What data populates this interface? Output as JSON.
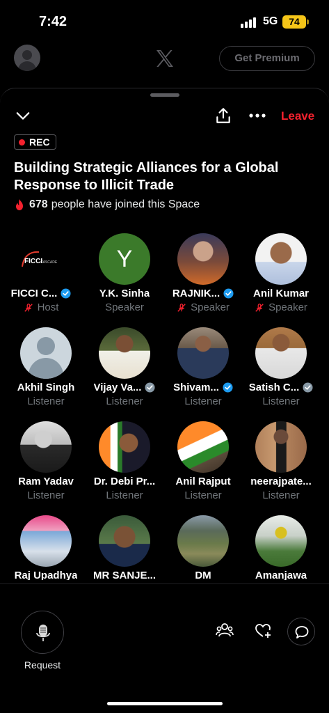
{
  "status_bar": {
    "time": "7:42",
    "network": "5G",
    "battery": "74"
  },
  "header": {
    "premium_label": "Get Premium"
  },
  "space": {
    "leave_label": "Leave",
    "rec_label": "REC",
    "title": "Building Strategic Alliances for a Global Response to Illicit Trade",
    "joined_count": "678",
    "joined_text": "people have joined this Space",
    "ficci_logo_text": "FICCI",
    "ficci_logo_sub": "CASCADE",
    "default_avatar_letter": "Y"
  },
  "participants": [
    {
      "name": "FICCI C...",
      "role": "Host",
      "verified": true,
      "muted": true,
      "avatar": "ficci-logo"
    },
    {
      "name": "Y.K. Sinha",
      "role": "Speaker",
      "verified": false,
      "muted": false,
      "avatar": "letter-y"
    },
    {
      "name": "RAJNIK...",
      "role": "Speaker",
      "verified": true,
      "muted": true,
      "avatar": "photo"
    },
    {
      "name": "Anil Kumar",
      "role": "Speaker",
      "verified": false,
      "muted": true,
      "avatar": "photo"
    },
    {
      "name": "Akhil Singh",
      "role": "Listener",
      "verified": false,
      "muted": false,
      "avatar": "default"
    },
    {
      "name": "Vijay Va...",
      "role": "Listener",
      "verified": true,
      "muted": false,
      "avatar": "photo"
    },
    {
      "name": "Shivam...",
      "role": "Listener",
      "verified": true,
      "muted": false,
      "avatar": "photo"
    },
    {
      "name": "Satish C...",
      "role": "Listener",
      "verified": true,
      "muted": false,
      "avatar": "photo"
    },
    {
      "name": "Ram Yadav",
      "role": "Listener",
      "verified": false,
      "muted": false,
      "avatar": "photo"
    },
    {
      "name": "Dr. Debi Pr...",
      "role": "Listener",
      "verified": false,
      "muted": false,
      "avatar": "photo"
    },
    {
      "name": "Anil Rajput",
      "role": "Listener",
      "verified": false,
      "muted": false,
      "avatar": "photo"
    },
    {
      "name": "neerajpate...",
      "role": "Listener",
      "verified": false,
      "muted": false,
      "avatar": "photo"
    },
    {
      "name": "Raj Upadhya",
      "role": "",
      "verified": false,
      "muted": false,
      "avatar": "photo"
    },
    {
      "name": "MR SANJE...",
      "role": "",
      "verified": false,
      "muted": false,
      "avatar": "photo"
    },
    {
      "name": "DM",
      "role": "",
      "verified": false,
      "muted": false,
      "avatar": "photo"
    },
    {
      "name": "Amanjawa",
      "role": "",
      "verified": false,
      "muted": false,
      "avatar": "photo"
    }
  ],
  "bottom_bar": {
    "request_label": "Request"
  },
  "colors": {
    "accent_red": "#f4212e",
    "verified_blue": "#1d9bf0",
    "muted_gray": "#71767b"
  }
}
